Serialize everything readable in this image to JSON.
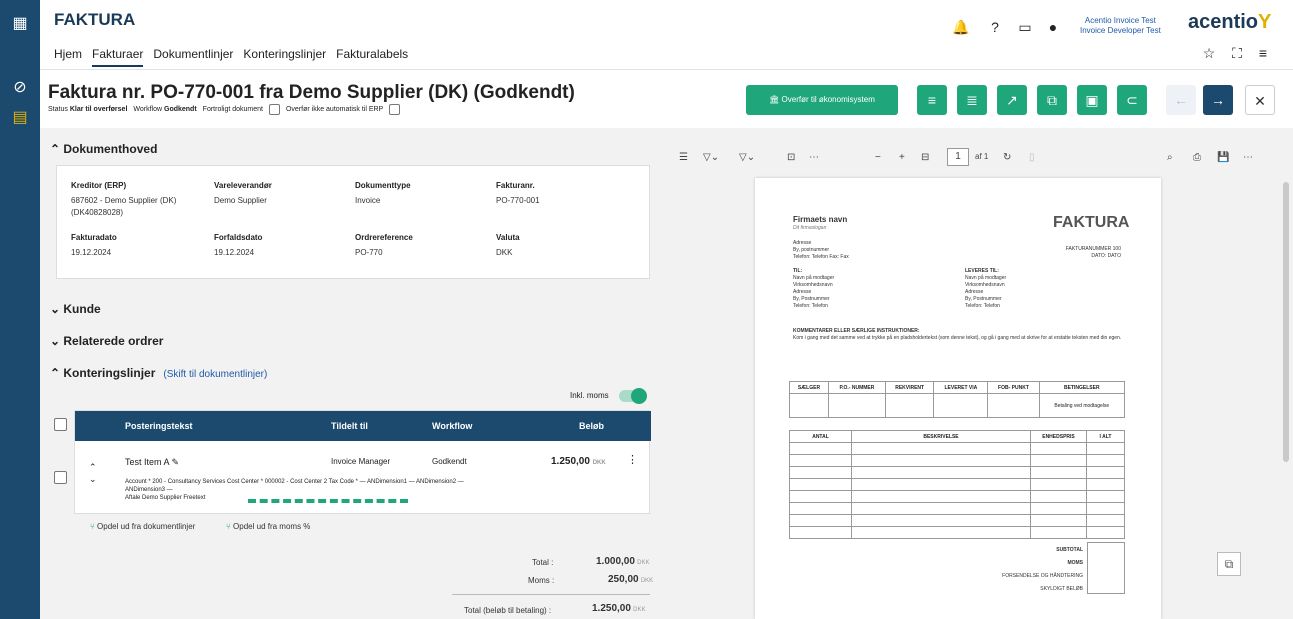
{
  "app": {
    "name": "FAKTURA",
    "user_line1": "Acentio Invoice Test",
    "user_line2": "Invoice Developer Test",
    "logo": "acentio"
  },
  "nav": {
    "items": [
      "Hjem",
      "Fakturaer",
      "Dokumentlinjer",
      "Konteringslinjer",
      "Fakturalabels"
    ],
    "active": "Fakturaer"
  },
  "header": {
    "title": "Faktura nr. PO-770-001 fra Demo Supplier (DK) (Godkendt)",
    "status_label": "Status",
    "status_value": "Klar til overførsel",
    "workflow_label": "Workflow",
    "workflow_value": "Godkendt",
    "confidential": "Fortroligt dokument",
    "no_auto": "Overfør ikke automatisk til ERP",
    "transfer_button": "Overfør til økonomisystem"
  },
  "doc_head": {
    "title": "Dokumenthoved",
    "creditor_label": "Kreditor (ERP)",
    "creditor_value": "687602 - Demo Supplier (DK)",
    "creditor_value2": "(DK40828028)",
    "supplier_label": "Vareleverandør",
    "supplier_value": "Demo Supplier",
    "doctype_label": "Dokumenttype",
    "doctype_value": "Invoice",
    "invoiceno_label": "Fakturanr.",
    "invoiceno_value": "PO-770-001",
    "invdate_label": "Fakturadato",
    "invdate_value": "19.12.2024",
    "duedate_label": "Forfaldsdato",
    "duedate_value": "19.12.2024",
    "orderref_label": "Ordrereference",
    "orderref_value": "PO-770",
    "currency_label": "Valuta",
    "currency_value": "DKK"
  },
  "sections": {
    "customer": "Kunde",
    "related": "Relaterede ordrer",
    "posting": "Konteringslinjer",
    "switch_link": "(Skift til dokumentlinjer)",
    "incl_vat": "Inkl. moms"
  },
  "table": {
    "headers": [
      "Posteringstekst",
      "Tildelt til",
      "Workflow",
      "Beløb"
    ],
    "row": {
      "text": "Test Item A",
      "assigned": "Invoice Manager",
      "workflow": "Godkendt",
      "amount": "1.250,00",
      "currency": "DKK",
      "detail1": "Account * 200 - Consultancy Services   Cost Center * 000002 - Cost Center 2   Tax Code * —  ANDimension1 —  ANDimension2 —",
      "detail2": "ANDimension3 —",
      "detail3": "Aftale  Demo Supplier Freetext"
    }
  },
  "actions": {
    "split_doc": "Opdel ud fra dokumentlinjer",
    "split_vat": "Opdel ud fra moms %"
  },
  "totals": {
    "total_label": "Total :",
    "total_value": "1.000,00",
    "vat_label": "Moms :",
    "vat_value": "250,00",
    "payable_label": "Total (beløb til betaling) :",
    "payable_value": "1.250,00",
    "currency": "DKK"
  },
  "viewer": {
    "page": "1",
    "of": "af 1"
  },
  "pdf": {
    "company": "Firmaets navn",
    "slogan": "Dit firmaslogan",
    "title": "FAKTURA",
    "addr1": "Adresse",
    "addr2": "By, postnummer",
    "addr3": "Telefon: Telefon Fax: Fax",
    "invno": "FAKTURANUMMER 100",
    "date": "DATO: DATO",
    "to": "TIL:",
    "to1": "Navn på modtager",
    "to2": "Virksomhedsnavn",
    "to3": "Adresse",
    "to4": "By, Postnummer",
    "to5": "Telefon: Telefon",
    "ship": "LEVERES TIL:",
    "ship1": "Navn på modtager",
    "ship2": "Virksomhedsnavn",
    "ship3": "Adresse",
    "ship4": "By, Postnummer",
    "ship5": "Telefon: Telefon",
    "comments": "KOMMENTARER ELLER SÆRLIGE INSTRUKTIONER:",
    "comments_text": "Kom i gang med det samme ved at trykke på en pladsholdertekst (som denne tekst), og gå i gang med at skrive for at erstatte teksten med din egen.",
    "grid1": [
      "SÆLGER",
      "P.O.- NUMMER",
      "REKVIRENT",
      "LEVERET VIA",
      "FOB- PUNKT",
      "BETINGELSER"
    ],
    "terms": "Betaling ved modtagelse",
    "grid2": [
      "ANTAL",
      "BESKRIVELSE",
      "ENHEDSPRIS",
      "I ALT"
    ],
    "subtotal": "SUBTOTAL",
    "vat": "MOMS",
    "shipping": "FORSENDELSE OG HÅNDTERING",
    "due": "SKYLDIGT BELØB"
  }
}
